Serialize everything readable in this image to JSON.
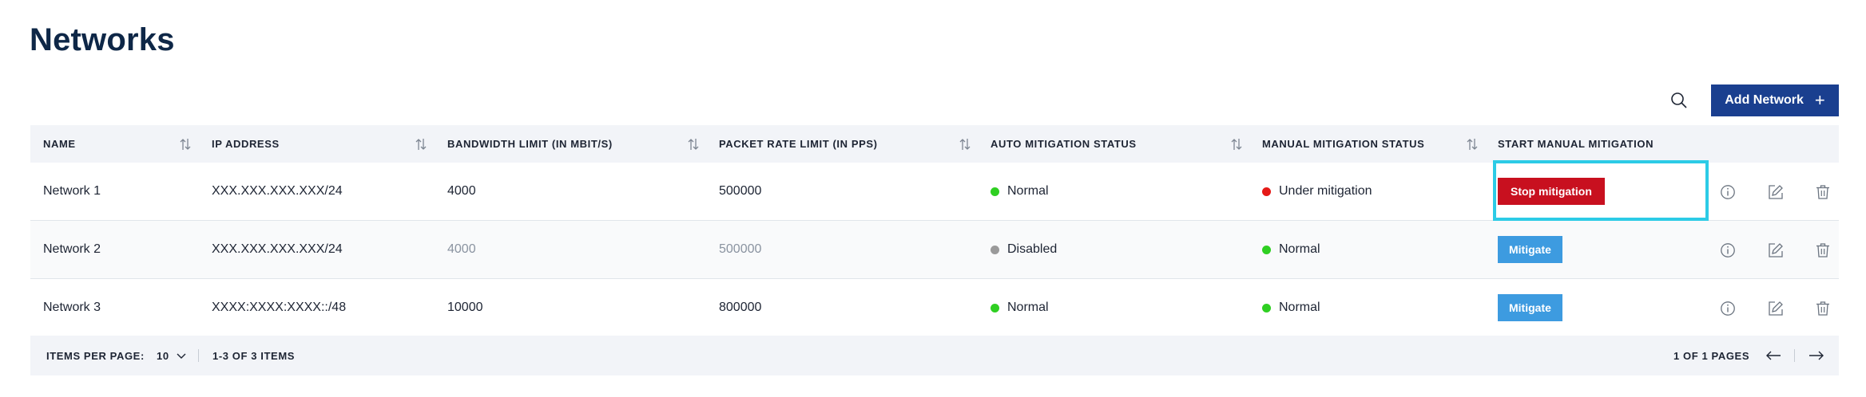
{
  "page": {
    "title": "Networks"
  },
  "toolbar": {
    "search_icon": "search-icon",
    "add_label": "Add Network",
    "add_icon": "plus-icon"
  },
  "table": {
    "columns": [
      {
        "label": "NAME",
        "sortable": true
      },
      {
        "label": "IP ADDRESS",
        "sortable": true
      },
      {
        "label": "BANDWIDTH LIMIT (IN MBIT/S)",
        "sortable": true
      },
      {
        "label": "PACKET RATE LIMIT (IN PPS)",
        "sortable": true
      },
      {
        "label": "AUTO MITIGATION STATUS",
        "sortable": true
      },
      {
        "label": "MANUAL MITIGATION STATUS",
        "sortable": true
      },
      {
        "label": "START MANUAL MITIGATION",
        "sortable": false
      }
    ],
    "rows": [
      {
        "name": "Network 1",
        "ip": "XXX.XXX.XXX.XXX/24",
        "bandwidth": "4000",
        "packet_rate": "500000",
        "limits_muted": false,
        "auto_status": "Normal",
        "auto_color": "#2fcf22",
        "manual_status": "Under mitigation",
        "manual_color": "#e51a17",
        "action": "Stop mitigation",
        "action_type": "stop"
      },
      {
        "name": "Network 2",
        "ip": "XXX.XXX.XXX.XXX/24",
        "bandwidth": "4000",
        "packet_rate": "500000",
        "limits_muted": true,
        "auto_status": "Disabled",
        "auto_color": "#9a9a9a",
        "manual_status": "Normal",
        "manual_color": "#2fcf22",
        "action": "Mitigate",
        "action_type": "start"
      },
      {
        "name": "Network 3",
        "ip": "XXXX:XXXX:XXXX::/48",
        "bandwidth": "10000",
        "packet_rate": "800000",
        "limits_muted": false,
        "auto_status": "Normal",
        "auto_color": "#2fcf22",
        "manual_status": "Normal",
        "manual_color": "#2fcf22",
        "action": "Mitigate",
        "action_type": "start"
      }
    ],
    "row_icons": [
      "info-icon",
      "edit-icon",
      "trash-icon"
    ]
  },
  "footer": {
    "items_per_page_label": "ITEMS PER PAGE:",
    "items_per_page_value": "10",
    "range": "1-3 OF 3 ITEMS",
    "pages": "1 OF 1 PAGES"
  },
  "colors": {
    "primary": "#1a3f8f",
    "danger": "#c8101f",
    "mitigate": "#3d9be0",
    "focus": "#2ccbe6",
    "title": "#0e2747"
  }
}
